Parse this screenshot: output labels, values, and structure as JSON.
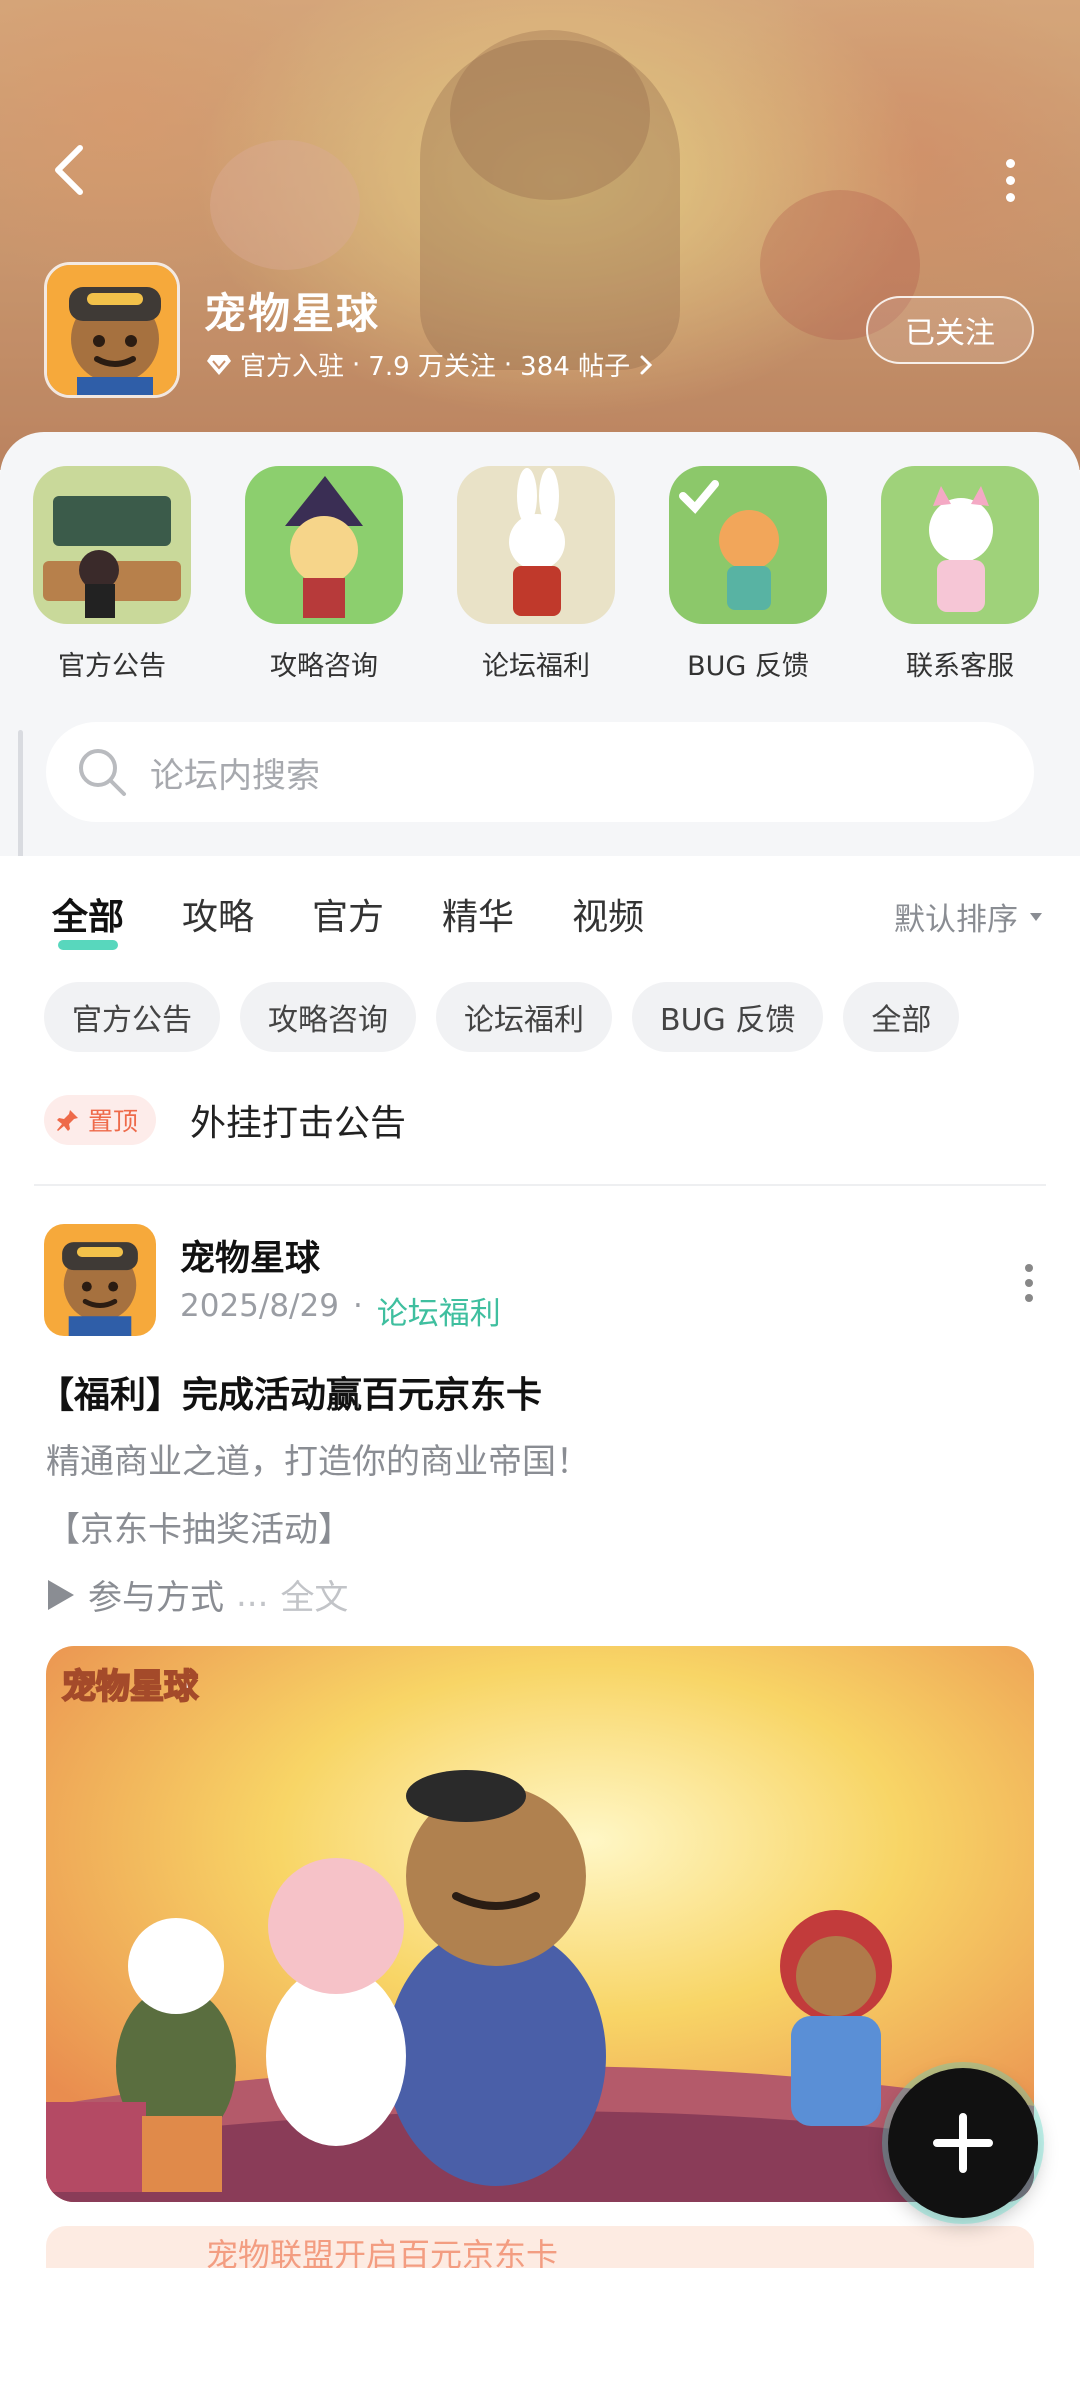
{
  "header": {
    "forum_name": "宠物星球",
    "verified_label": "官方入驻",
    "followers": "7.9 万关注",
    "posts": "384 帖子",
    "separator": "·",
    "follow_button": "已关注"
  },
  "quick_links": [
    {
      "label": "官方公告",
      "icon": "announcement-icon"
    },
    {
      "label": "攻略咨询",
      "icon": "guide-icon"
    },
    {
      "label": "论坛福利",
      "icon": "welfare-icon"
    },
    {
      "label": "BUG 反馈",
      "icon": "bug-feedback-icon"
    },
    {
      "label": "联系客服",
      "icon": "customer-service-icon"
    }
  ],
  "search": {
    "placeholder": "论坛内搜索"
  },
  "tabs": [
    {
      "label": "全部",
      "active": true
    },
    {
      "label": "攻略",
      "active": false
    },
    {
      "label": "官方",
      "active": false
    },
    {
      "label": "精华",
      "active": false
    },
    {
      "label": "视频",
      "active": false
    }
  ],
  "sort_label": "默认排序",
  "chips": [
    "官方公告",
    "攻略咨询",
    "论坛福利",
    "BUG 反馈",
    "全部"
  ],
  "pinned": {
    "badge": "置顶",
    "title": "外挂打击公告"
  },
  "post": {
    "author": "宠物星球",
    "date": "2025/8/29",
    "separator": "·",
    "category": "论坛福利",
    "title": "【福利】完成活动赢百元京东卡",
    "line1": "精通商业之道，打造你的商业帝国！",
    "line2": "【京东卡抽奖活动】",
    "line3": "参与方式",
    "ellipsis": "...",
    "fulltext": "全文",
    "image_logo": "宠物星球"
  },
  "promo": {
    "text": "宠物联盟开启百元京东卡"
  },
  "colors": {
    "accent": "#46d3b6",
    "category": "#3fbf9f",
    "pin": "#ee6a4a"
  }
}
